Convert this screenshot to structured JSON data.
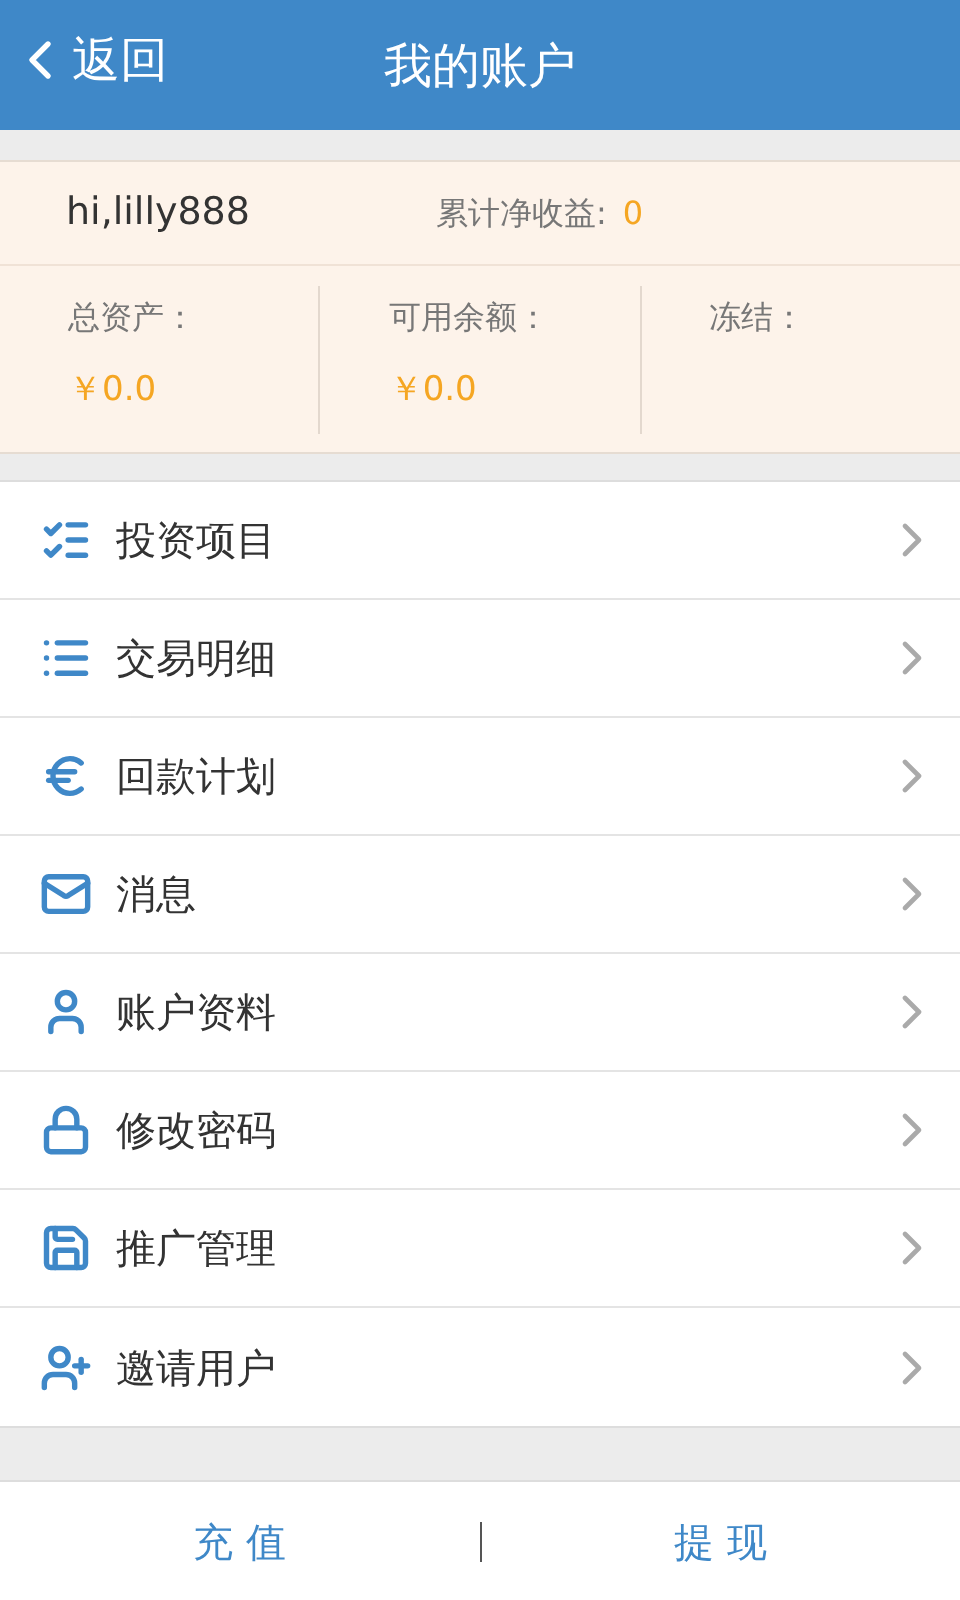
{
  "header": {
    "back": "返回",
    "title": "我的账户"
  },
  "summary": {
    "greeting": "hi,lilly888",
    "earnings_label": "累计净收益:",
    "earnings_value": "0",
    "stats": [
      {
        "label": "总资产：",
        "value": "￥0.0"
      },
      {
        "label": "可用余额：",
        "value": "￥0.0"
      },
      {
        "label": "冻结："
      }
    ]
  },
  "menu": [
    {
      "kind": "project-list",
      "label": "投资项目"
    },
    {
      "kind": "list",
      "label": "交易明细"
    },
    {
      "kind": "euro",
      "label": "回款计划"
    },
    {
      "kind": "mail",
      "label": "消息"
    },
    {
      "kind": "user",
      "label": "账户资料"
    },
    {
      "kind": "lock",
      "label": "修改密码"
    },
    {
      "kind": "save",
      "label": "推广管理"
    },
    {
      "kind": "user-add",
      "label": "邀请用户"
    }
  ],
  "bottom_buttons": [
    "充 值",
    "提 现"
  ]
}
